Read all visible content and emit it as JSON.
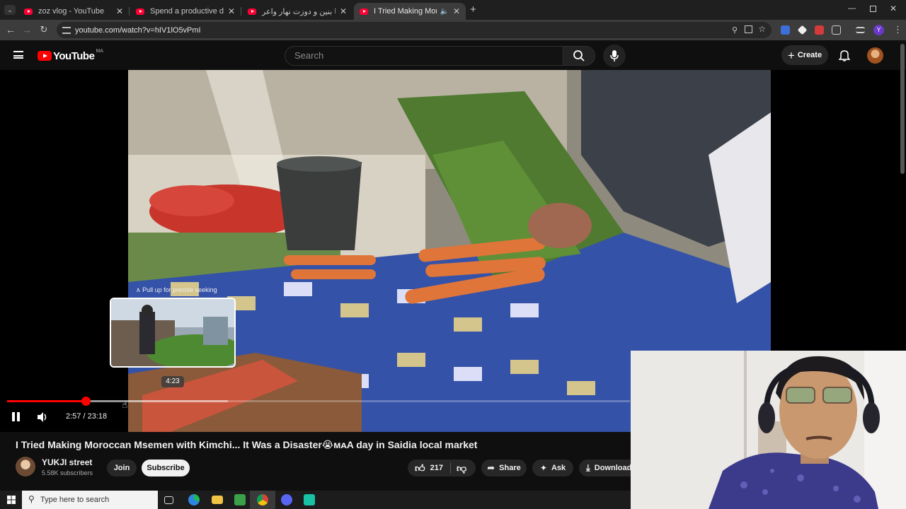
{
  "browser": {
    "tabs": [
      {
        "title": "zoz vlog - YouTube",
        "active": false
      },
      {
        "title": "Spend a productive day with m",
        "active": false
      },
      {
        "title": "طيبت عشا بنين و دوزت نهار واعر",
        "active": false
      },
      {
        "title": "I Tried Making Moroccan M",
        "active": true
      }
    ],
    "url": "youtube.com/watch?v=hIV1lO5vPmI",
    "colors": {
      "tabstrip": "#1f1f1f",
      "toolbar": "#3c3c3c"
    }
  },
  "youtube": {
    "logo_text": "YouTube",
    "country_code": "MA",
    "search_placeholder": "Search",
    "create_label": "Create",
    "accent_color": "#ff0000"
  },
  "player": {
    "hint": "∧ Pull up for precise seeking",
    "hover_time": "4:23",
    "current_time": "2:57",
    "duration": "23:18",
    "time_display": "2:57 / 23:18",
    "played_fraction": 0.1266,
    "buffered_fraction": 0.355,
    "hover_fraction": 0.189
  },
  "video": {
    "title": "I Tried Making Moroccan Msemen with Kimchi... It Was a Disaster😭ᴍᴀA day in Saidia local market",
    "channel_name": "YUKJI street",
    "subscribers": "5.58K subscribers",
    "join_label": "Join",
    "subscribe_label": "Subscribe",
    "likes": "217",
    "share_label": "Share",
    "ask_label": "Ask",
    "download_label": "Download"
  },
  "taskbar": {
    "search_placeholder": "Type here to search"
  }
}
